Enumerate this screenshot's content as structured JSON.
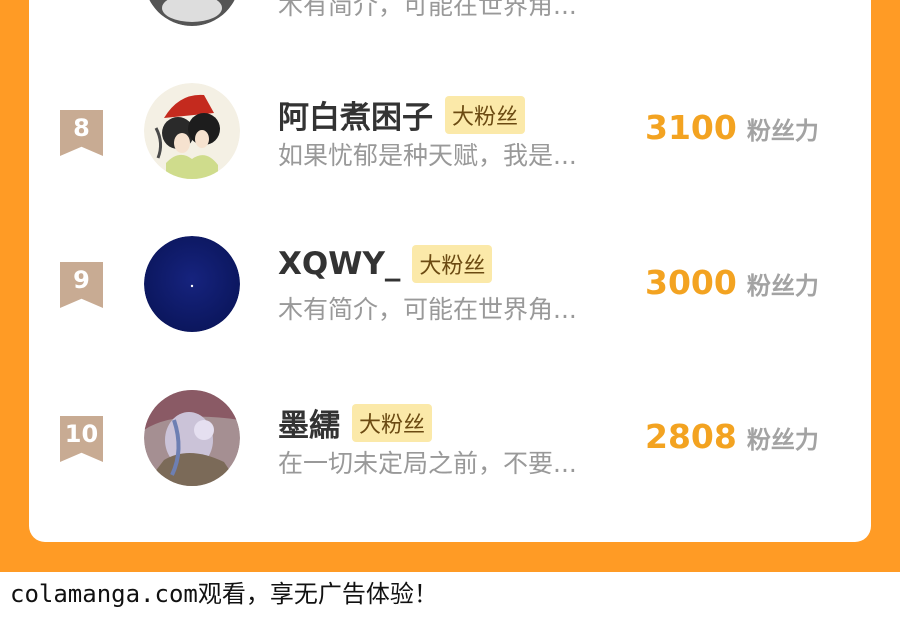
{
  "top_partial": {
    "desc": "木有简介，可能在世界角..."
  },
  "rows": [
    {
      "rank": "8",
      "name": "阿白煮困子",
      "badge": "大粉丝",
      "desc": "如果忧郁是种天赋，我是...",
      "score": "3100",
      "unit": "粉丝力"
    },
    {
      "rank": "9",
      "name": "XQWY_",
      "badge": "大粉丝",
      "desc": "木有简介，可能在世界角...",
      "score": "3000",
      "unit": "粉丝力"
    },
    {
      "rank": "10",
      "name": "墨繻",
      "badge": "大粉丝",
      "desc": "在一切未定局之前，不要...",
      "score": "2808",
      "unit": "粉丝力"
    }
  ],
  "footer": {
    "text": "colamanga.com观看，享无广告体验！"
  },
  "colors": {
    "background": "#ff9b25",
    "rank_badge": "#c8ab93",
    "score": "#f3a321",
    "fan_badge": "#fbe9a9"
  }
}
